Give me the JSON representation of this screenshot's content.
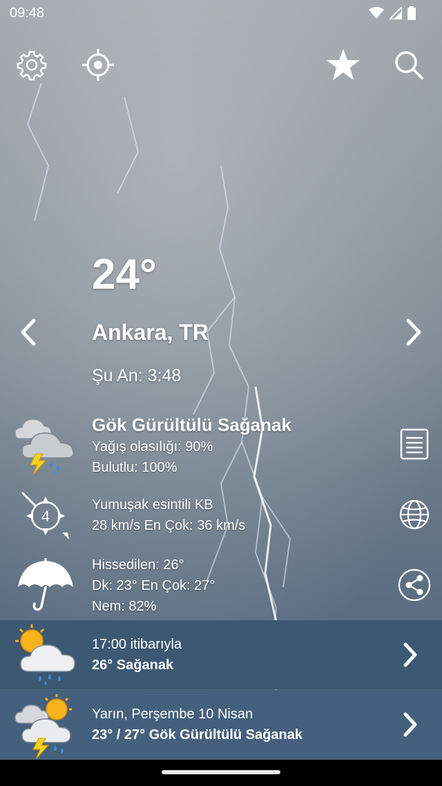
{
  "status_bar": {
    "time": "09:48",
    "icons": [
      "wifi-icon",
      "signal-icon",
      "battery-icon"
    ]
  },
  "top_bar": {
    "icons": [
      "settings-icon",
      "location-target-icon",
      "favorite-star-icon",
      "search-icon"
    ]
  },
  "current": {
    "temperature": "24°",
    "location": "Ankara, TR",
    "time_label": "Şu An: 3:48"
  },
  "condition": {
    "title": "Gök Gürültülü Sağanak",
    "precip": "Yağış olasılığı: 90%",
    "cloud": "Bulutlu: 100%",
    "icon": "thunderstorm-cloud-icon"
  },
  "wind": {
    "desc": "Yumuşak esintili KB",
    "speed": "28 km/s En Çok: 36 km/s",
    "beaufort": "4",
    "icon": "wind-compass-icon"
  },
  "feels": {
    "feels_like": "Hissedilen: 26°",
    "min_max": "Dk: 23° En Çok: 27°",
    "humidity": "Nem: 82%",
    "icon": "umbrella-icon"
  },
  "side_buttons": [
    "details-list-icon",
    "globe-icon",
    "share-icon"
  ],
  "forecasts": [
    {
      "line1": "17:00 itibarıyla",
      "line2": "26° Sağanak",
      "icon": "sun-cloud-rain-icon"
    },
    {
      "line1": "Yarın, Perşembe 10 Nisan",
      "line2": "23° / 27° Gök Gürültülü Sağanak",
      "icon": "sun-cloud-thunder-icon"
    }
  ],
  "colors": {
    "forecast_row_1": "#3c5873",
    "forecast_row_2": "#44607c",
    "lightning": "#ffd21f",
    "raindrop": "#3a8fe0",
    "sun": "#f7b31c"
  }
}
